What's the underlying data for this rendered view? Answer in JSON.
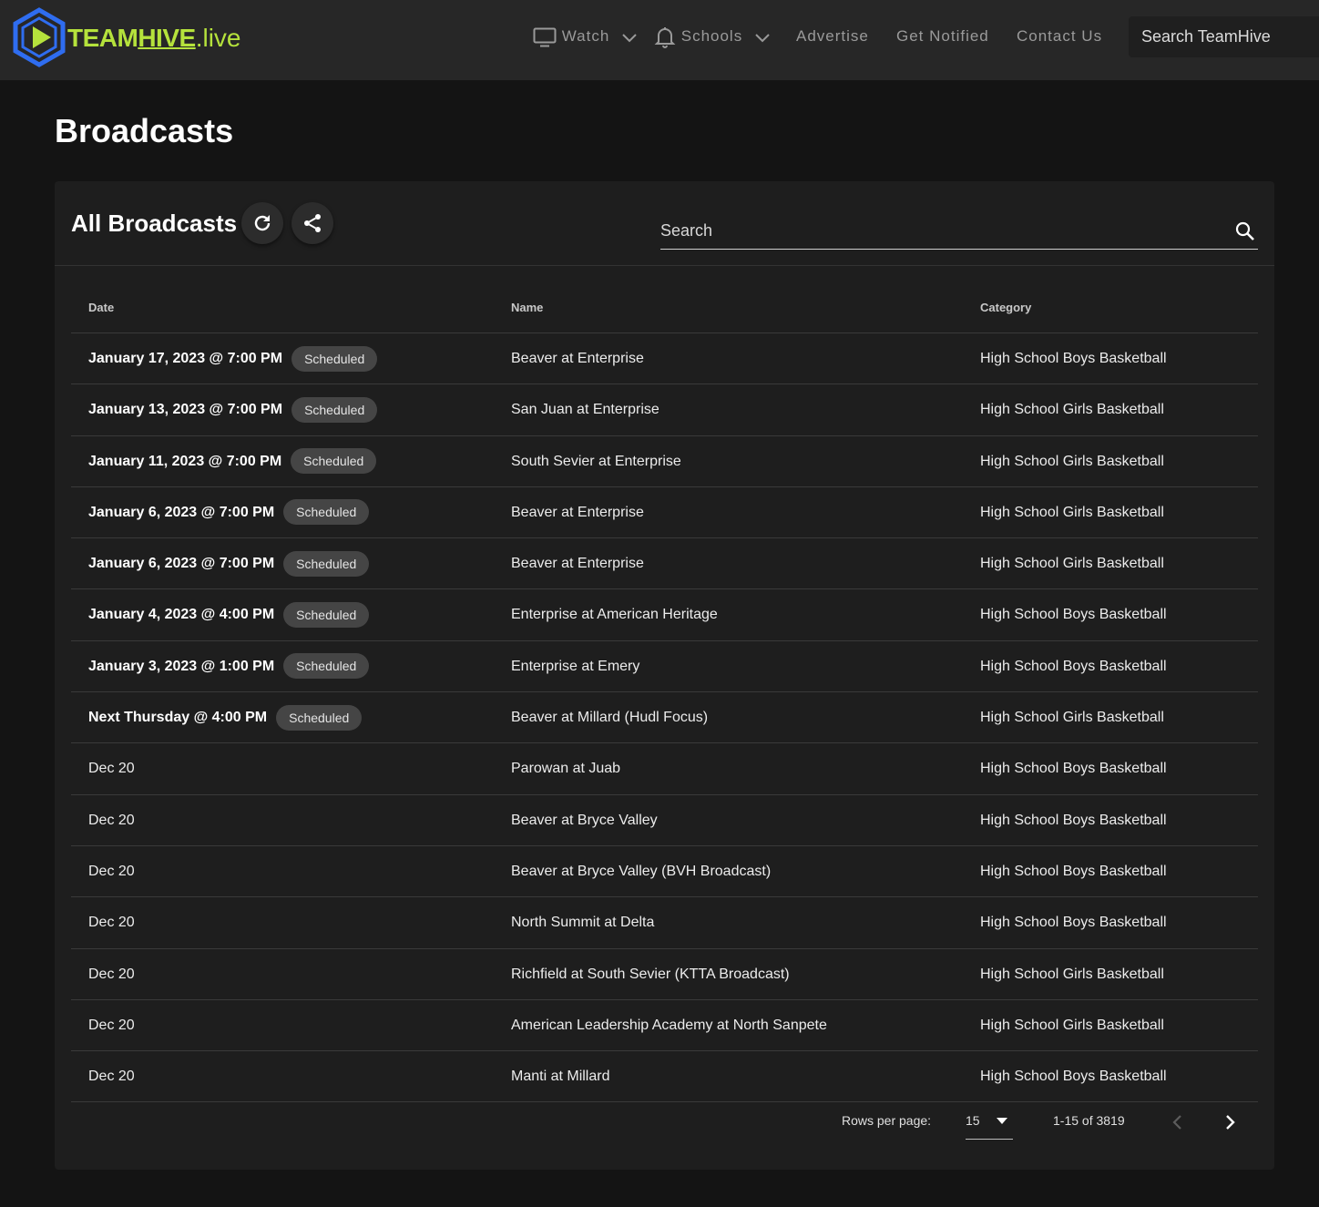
{
  "brand": {
    "name_part1": "TEAM",
    "name_part2": "HIVE",
    "tld": ".live",
    "accent": "#b5e23c",
    "logo_color": "#2f6df0"
  },
  "nav": {
    "watch": "Watch",
    "schools": "Schools",
    "advertise": "Advertise",
    "get_notified": "Get Notified",
    "contact": "Contact Us",
    "search_placeholder": "Search TeamHive"
  },
  "page": {
    "title": "Broadcasts"
  },
  "card": {
    "title": "All Broadcasts",
    "search_placeholder": "Search"
  },
  "table": {
    "headers": {
      "date": "Date",
      "name": "Name",
      "category": "Category"
    },
    "rows": [
      {
        "date": "January 17, 2023 @ 7:00 PM",
        "status": "Scheduled",
        "name": "Beaver at Enterprise",
        "category": "High School Boys Basketball"
      },
      {
        "date": "January 13, 2023 @ 7:00 PM",
        "status": "Scheduled",
        "name": "San Juan at Enterprise",
        "category": "High School Girls Basketball"
      },
      {
        "date": "January 11, 2023 @ 7:00 PM",
        "status": "Scheduled",
        "name": "South Sevier at Enterprise",
        "category": "High School Girls Basketball"
      },
      {
        "date": "January 6, 2023 @ 7:00 PM",
        "status": "Scheduled",
        "name": "Beaver at Enterprise",
        "category": "High School Girls Basketball"
      },
      {
        "date": "January 6, 2023 @ 7:00 PM",
        "status": "Scheduled",
        "name": "Beaver at Enterprise",
        "category": "High School Girls Basketball"
      },
      {
        "date": "January 4, 2023 @ 4:00 PM",
        "status": "Scheduled",
        "name": "Enterprise at American Heritage",
        "category": "High School Boys Basketball"
      },
      {
        "date": "January 3, 2023 @ 1:00 PM",
        "status": "Scheduled",
        "name": "Enterprise at Emery",
        "category": "High School Boys Basketball"
      },
      {
        "date": "Next Thursday @ 4:00 PM",
        "status": "Scheduled",
        "name": "Beaver at Millard (Hudl Focus)",
        "category": "High School Girls Basketball"
      },
      {
        "date": "Dec 20",
        "status": "",
        "name": "Parowan at Juab",
        "category": "High School Boys Basketball"
      },
      {
        "date": "Dec 20",
        "status": "",
        "name": "Beaver at Bryce Valley",
        "category": "High School Boys Basketball"
      },
      {
        "date": "Dec 20",
        "status": "",
        "name": "Beaver at Bryce Valley (BVH Broadcast)",
        "category": "High School Boys Basketball"
      },
      {
        "date": "Dec 20",
        "status": "",
        "name": "North Summit at Delta",
        "category": "High School Boys Basketball"
      },
      {
        "date": "Dec 20",
        "status": "",
        "name": "Richfield at South Sevier (KTTA Broadcast)",
        "category": "High School Girls Basketball"
      },
      {
        "date": "Dec 20",
        "status": "",
        "name": "American Leadership Academy at North Sanpete",
        "category": "High School Girls Basketball"
      },
      {
        "date": "Dec 20",
        "status": "",
        "name": "Manti at Millard",
        "category": "High School Boys Basketball"
      }
    ]
  },
  "pagination": {
    "rows_per_page_label": "Rows per page:",
    "rows_per_page": "15",
    "range": "1-15 of 3819"
  }
}
